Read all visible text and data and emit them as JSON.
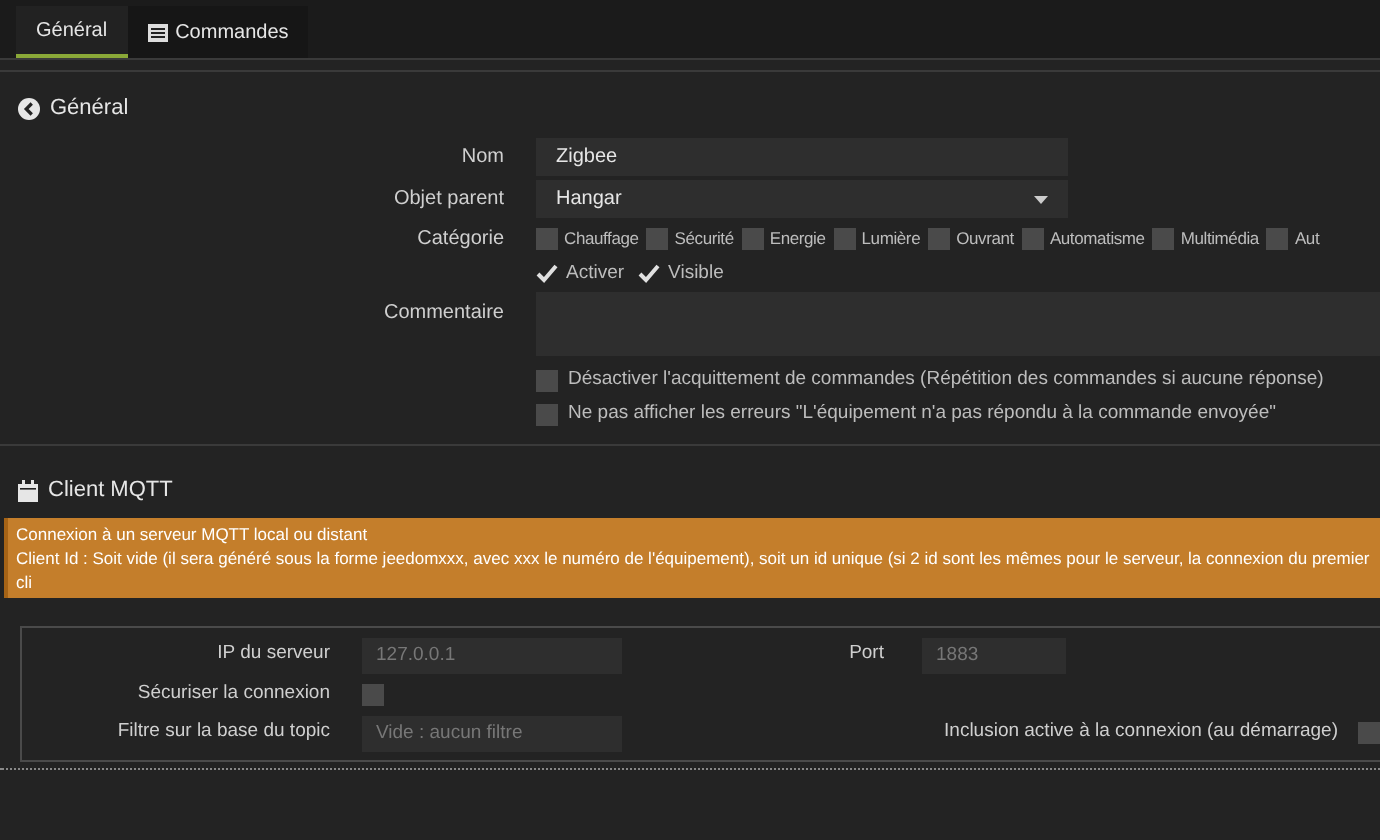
{
  "tabs": [
    {
      "label": "Général",
      "selected": true,
      "kind": "plain"
    },
    {
      "label": "Commandes",
      "selected": false,
      "kind": "list"
    }
  ],
  "general": {
    "title": "Général",
    "name": {
      "label": "Nom",
      "value": "Zigbee"
    },
    "parent": {
      "label": "Objet parent",
      "value": "Hangar"
    },
    "category": {
      "label": "Catégorie",
      "options": [
        {
          "label": "Chauffage",
          "checked": false
        },
        {
          "label": "Sécurité",
          "checked": false
        },
        {
          "label": "Energie",
          "checked": false
        },
        {
          "label": "Lumière",
          "checked": false
        },
        {
          "label": "Ouvrant",
          "checked": false
        },
        {
          "label": "Automatisme",
          "checked": false
        },
        {
          "label": "Multimédia",
          "checked": false
        },
        {
          "label": "Aut",
          "checked": false
        }
      ]
    },
    "flags": [
      {
        "label": "Activer",
        "checked": true
      },
      {
        "label": "Visible",
        "checked": true
      }
    ],
    "comment": {
      "label": "Commentaire"
    },
    "options": [
      {
        "label": "Désactiver l'acquittement de commandes (Répétition des commandes si aucune réponse)",
        "checked": false
      },
      {
        "label": "Ne pas afficher les erreurs \"L'équipement n'a pas répondu à la commande envoyée\"",
        "checked": false
      }
    ]
  },
  "mqtt": {
    "title": "Client MQTT",
    "alert": [
      "Connexion à un serveur MQTT local ou distant",
      "Client Id : Soit vide (il sera généré sous la forme jeedomxxx, avec xxx le numéro de l'équipement), soit un id unique (si 2 id sont les mêmes pour le serveur, la connexion du premier cli"
    ],
    "server_ip": {
      "label": "IP du serveur",
      "placeholder": "127.0.0.1"
    },
    "port": {
      "label": "Port",
      "placeholder": "1883"
    },
    "secure": {
      "label": "Sécuriser la connexion",
      "checked": false
    },
    "topic_filter": {
      "label": "Filtre sur la base du topic",
      "placeholder": "Vide : aucun filtre"
    },
    "inclusion": {
      "label": "Inclusion active à la connexion (au démarrage)",
      "checked": false
    }
  }
}
